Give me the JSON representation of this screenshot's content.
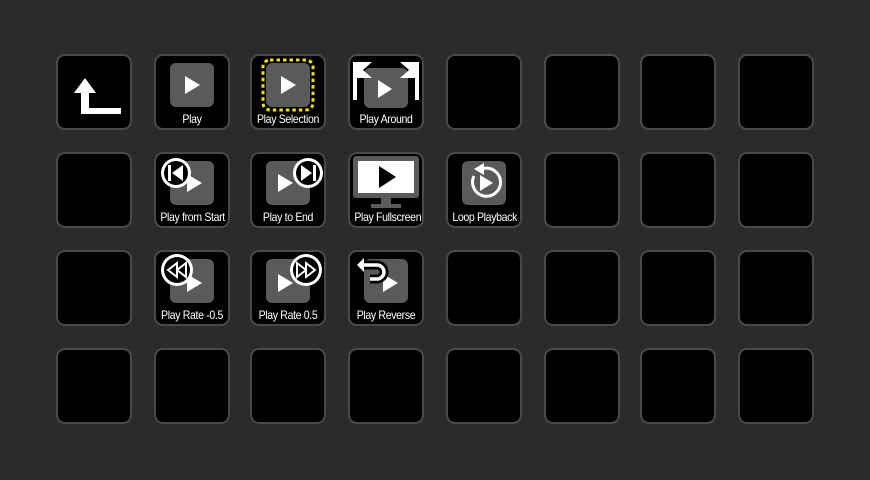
{
  "deck": {
    "keys": [
      {
        "label": "",
        "icon": "back-arrow-icon"
      },
      {
        "label": "Play",
        "icon": "play-icon"
      },
      {
        "label": "Play Selection",
        "icon": "play-selection-icon"
      },
      {
        "label": "Play Around",
        "icon": "play-around-icon"
      },
      {
        "label": "Play from Start",
        "icon": "play-from-start-icon"
      },
      {
        "label": "Play to End",
        "icon": "play-to-end-icon"
      },
      {
        "label": "Play Fullscreen",
        "icon": "play-fullscreen-icon"
      },
      {
        "label": "Loop Playback",
        "icon": "loop-playback-icon"
      },
      {
        "label": "Play Rate -0.5",
        "icon": "play-rate-minus-icon"
      },
      {
        "label": "Play Rate 0.5",
        "icon": "play-rate-plus-icon"
      },
      {
        "label": "Play Reverse",
        "icon": "play-reverse-icon"
      }
    ]
  },
  "colors": {
    "background": "#2b2b2b",
    "key": "#000000",
    "key_border": "#4a4a4a",
    "icon_gray": "#5a5a5a",
    "highlight": "#f5e000"
  }
}
